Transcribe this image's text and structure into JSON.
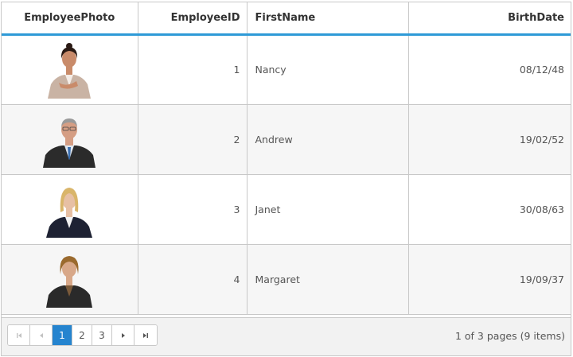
{
  "columns": {
    "photo": "EmployeePhoto",
    "id": "EmployeeID",
    "first": "FirstName",
    "birth": "BirthDate"
  },
  "rows": [
    {
      "id": "1",
      "first": "Nancy",
      "birth": "08/12/48",
      "photo": "photo-nancy"
    },
    {
      "id": "2",
      "first": "Andrew",
      "birth": "19/02/52",
      "photo": "photo-andrew"
    },
    {
      "id": "3",
      "first": "Janet",
      "birth": "30/08/63",
      "photo": "photo-janet"
    },
    {
      "id": "4",
      "first": "Margaret",
      "birth": "19/09/37",
      "photo": "photo-margaret"
    }
  ],
  "pager": {
    "first_icon": "first-page-icon",
    "prev_icon": "previous-page-icon",
    "pages": [
      "1",
      "2",
      "3"
    ],
    "current_page": "1",
    "next_icon": "next-page-icon",
    "last_icon": "last-page-icon",
    "info": "1 of 3 pages (9 items)"
  },
  "colors": {
    "header_accent": "#2e9ad7",
    "active_page": "#2584cf",
    "alt_row": "#f6f6f6"
  }
}
